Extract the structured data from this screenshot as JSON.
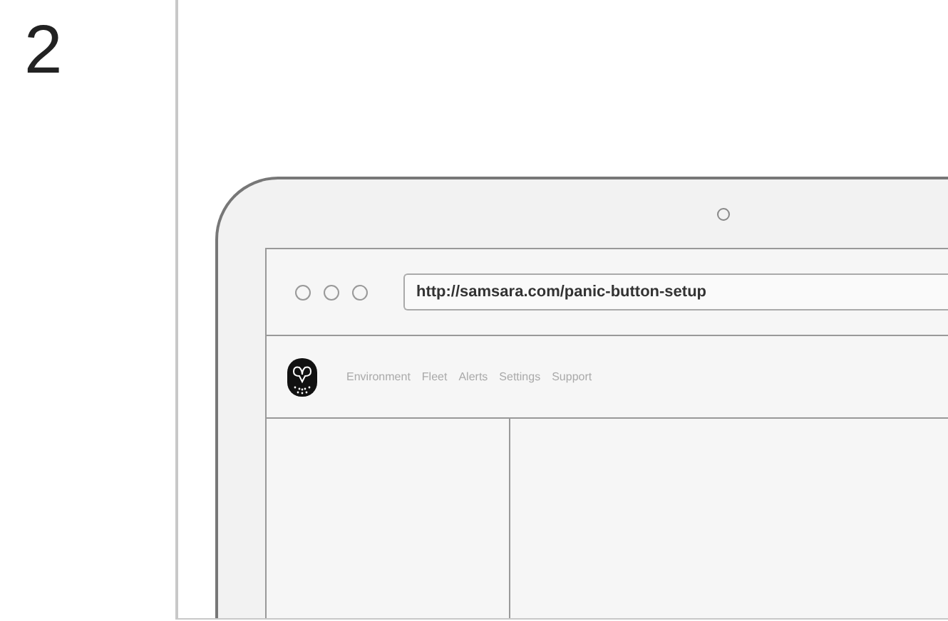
{
  "step_number": "2",
  "browser": {
    "url": "http://samsara.com/panic-button-setup"
  },
  "nav": {
    "items": [
      {
        "label": "Environment"
      },
      {
        "label": "Fleet"
      },
      {
        "label": "Alerts"
      },
      {
        "label": "Settings"
      },
      {
        "label": "Support"
      }
    ]
  }
}
